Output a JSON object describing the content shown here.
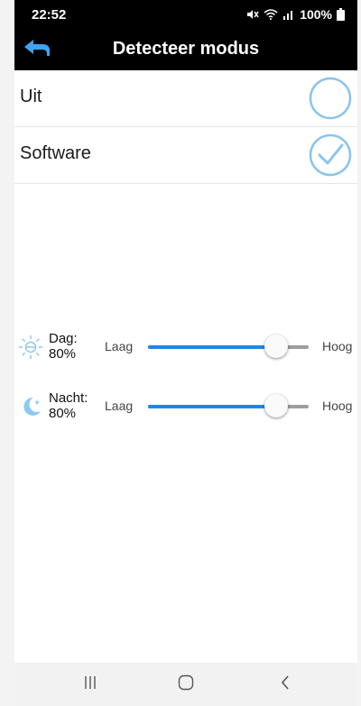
{
  "status_bar": {
    "time": "22:52",
    "battery": "100%"
  },
  "app_bar": {
    "title": "Detecteer modus",
    "back_icon": "back-arrow-icon"
  },
  "options": [
    {
      "label": "Uit",
      "selected": false
    },
    {
      "label": "Software",
      "selected": true
    }
  ],
  "sliders": [
    {
      "label": "Dag:",
      "percent": "80%",
      "value": 80,
      "icon": "sun-icon",
      "min_label": "Laag",
      "max_label": "Hoog"
    },
    {
      "label": "Nacht:",
      "percent": "80%",
      "value": 80,
      "icon": "moon-icon",
      "min_label": "Laag",
      "max_label": "Hoog"
    }
  ],
  "nav_bar": {
    "icons": [
      "recent-apps-icon",
      "home-icon",
      "back-icon"
    ]
  },
  "colors": {
    "accent": "#1e88e5",
    "radio": "#8ac4ee",
    "icon": "#8ec9f0"
  }
}
